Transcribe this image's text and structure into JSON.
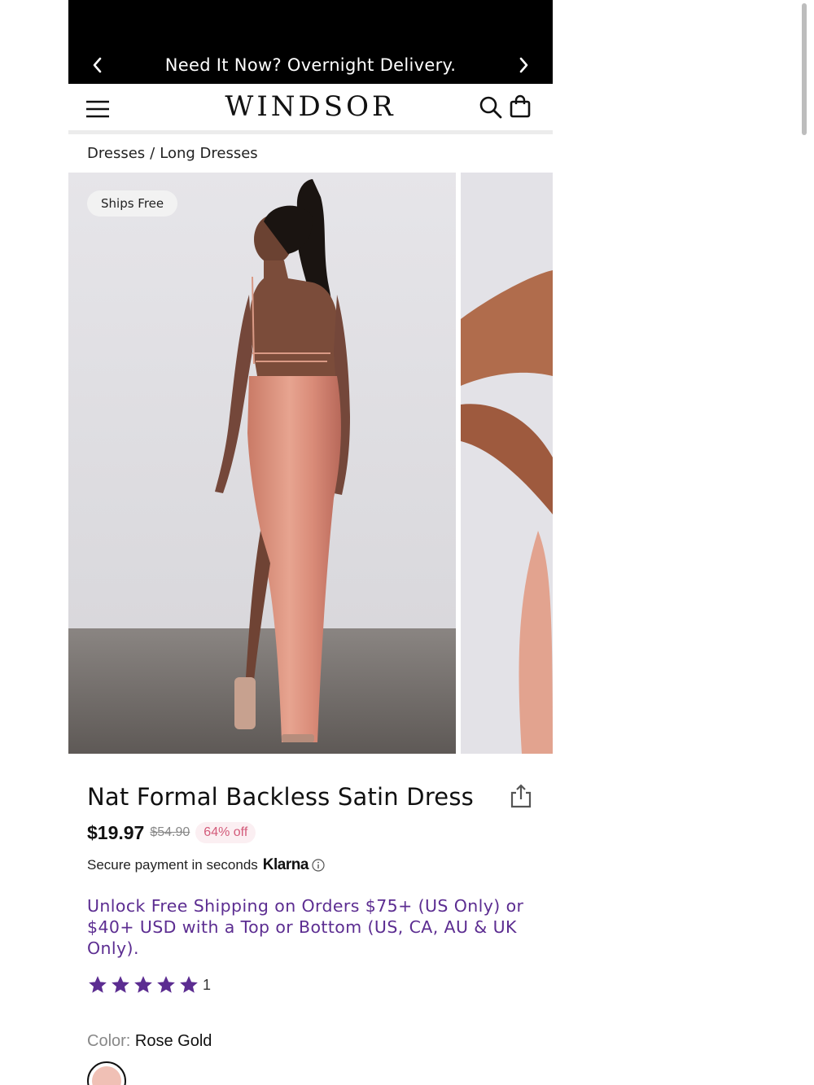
{
  "promo": {
    "message": "Need It Now? Overnight Delivery."
  },
  "header": {
    "logo": "WINDSOR"
  },
  "breadcrumb": {
    "items": [
      "Dresses",
      "Long Dresses"
    ],
    "separator": "/"
  },
  "gallery": {
    "badge": "Ships Free"
  },
  "product": {
    "title": "Nat Formal Backless Satin Dress",
    "price": "$19.97",
    "original_price": "$54.90",
    "discount": "64% off",
    "payment_text": "Secure payment in seconds",
    "payment_brand": "Klarna",
    "shipping_message": "Unlock Free Shipping on Orders $75+ (US Only) or $40+ USD with a Top or Bottom (US, CA, AU & UK Only).",
    "rating": {
      "stars": 5,
      "count": "1"
    },
    "color_label": "Color:",
    "color_value": "Rose Gold"
  },
  "colors": {
    "banner": "#000000",
    "accent_purple": "#5c2d91",
    "discount": "#d35b7a",
    "dress": "#d98b78",
    "swatch": "#f0c0b5"
  },
  "icons": [
    "chevron-left-icon",
    "chevron-right-icon",
    "hamburger-menu-icon",
    "search-icon",
    "shopping-bag-icon",
    "share-icon",
    "info-icon",
    "star-icon"
  ]
}
